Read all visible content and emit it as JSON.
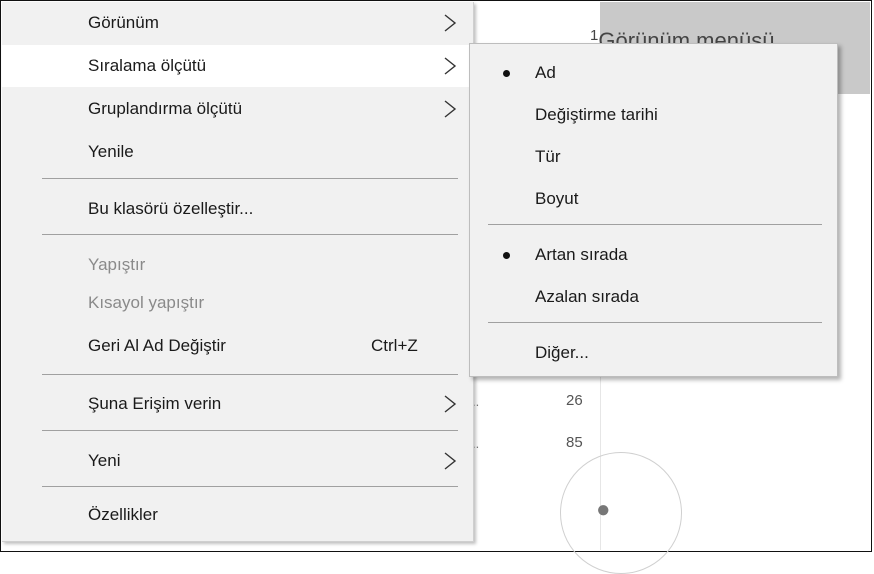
{
  "background": {
    "header_text": "Görünüm menüsü",
    "header_num": "1",
    "row_values": [
      "26",
      "85"
    ],
    "ellipsis": ".."
  },
  "context_menu": {
    "items": [
      {
        "label": "Görünüm",
        "submenu": true
      },
      {
        "label": "Sıralama ölçütü",
        "submenu": true,
        "highlighted": true
      },
      {
        "label": "Gruplandırma ölçütü",
        "submenu": true
      },
      {
        "label": "Yenile"
      },
      {
        "label": "Bu klasörü özelleştir..."
      },
      {
        "label": "Yapıştır",
        "disabled": true
      },
      {
        "label": "Kısayol yapıştır",
        "disabled": true
      },
      {
        "label": "Geri Al Ad Değiştir",
        "shortcut": "Ctrl+Z"
      },
      {
        "label": "Şuna Erişim verin",
        "submenu": true
      },
      {
        "label": "Yeni",
        "submenu": true
      },
      {
        "label": "Özellikler"
      }
    ]
  },
  "sort_submenu": {
    "items": [
      {
        "label": "Ad",
        "checked": true
      },
      {
        "label": "Değiştirme tarihi"
      },
      {
        "label": "Tür"
      },
      {
        "label": "Boyut"
      },
      {
        "label": "Artan sırada",
        "checked": true
      },
      {
        "label": "Azalan sırada"
      },
      {
        "label": "Diğer..."
      }
    ]
  },
  "icons": {
    "chevron": "chevron-right-icon",
    "bullet": "radio-bullet-icon",
    "person": "person-icon"
  }
}
